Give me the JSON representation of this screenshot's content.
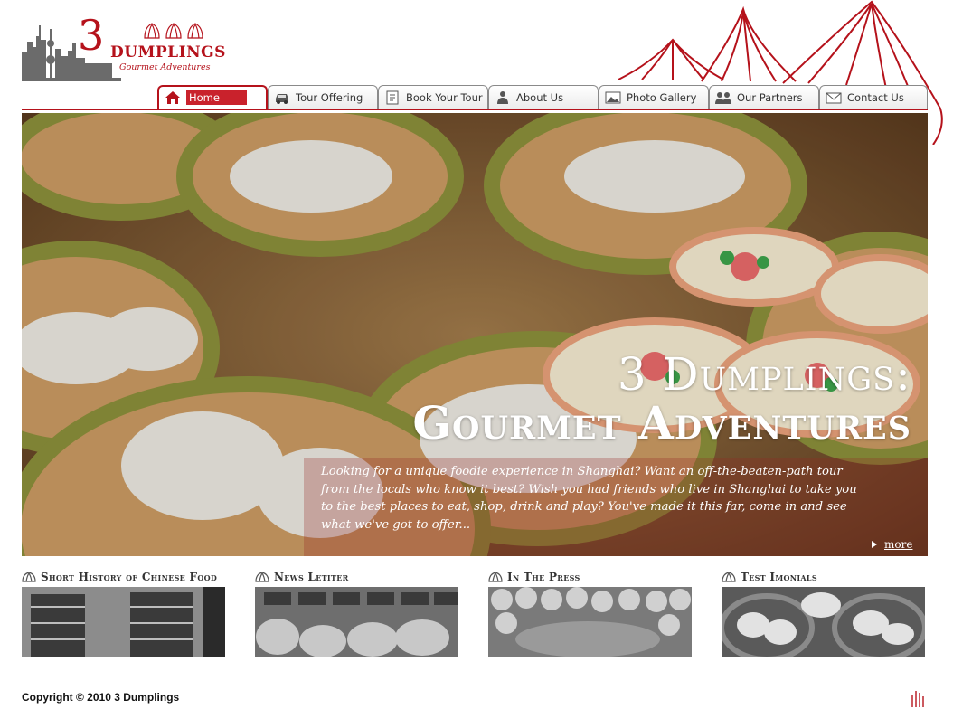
{
  "brand": {
    "number": "3",
    "name": "DUMPLINGS",
    "tagline": "Gourmet Adventures",
    "accent_color": "#b5121b"
  },
  "nav": {
    "tabs": [
      {
        "label": "Home",
        "icon": "home-icon",
        "active": true
      },
      {
        "label": "Tour Offering",
        "icon": "car-icon",
        "active": false
      },
      {
        "label": "Book Your Tour",
        "icon": "book-icon",
        "active": false
      },
      {
        "label": "About Us",
        "icon": "person-icon",
        "active": false
      },
      {
        "label": "Photo Gallery",
        "icon": "photo-icon",
        "active": false
      },
      {
        "label": "Our Partners",
        "icon": "people-icon",
        "active": false
      },
      {
        "label": "Contact Us",
        "icon": "envelope-icon",
        "active": false
      }
    ]
  },
  "hero": {
    "title_line1": "3 Dumplings:",
    "title_line2": "Gourmet Adventures",
    "text": "Looking for a unique foodie experience in Shanghai? Want an off-the-beaten-path tour from the locals who know it best? Wish you had friends who live in Shanghai to take you to the best places to eat, shop, drink and play? You've made it this far, come in and see what we've got to offer...",
    "more_label": "more"
  },
  "features": [
    {
      "heading": "Short History of Chinese Food",
      "icon": "dumpling-icon",
      "image": "steamer-stack-photo"
    },
    {
      "heading": "News Letiter",
      "icon": "dumpling-icon",
      "image": "market-spices-photo"
    },
    {
      "heading": "In The Press",
      "icon": "dumpling-icon",
      "image": "dumplings-tray-photo"
    },
    {
      "heading": "Test Imonials",
      "icon": "dumpling-icon",
      "image": "dim-sum-photo"
    }
  ],
  "footer": {
    "copyright": "Copyright © 2010 3 Dumplings"
  }
}
